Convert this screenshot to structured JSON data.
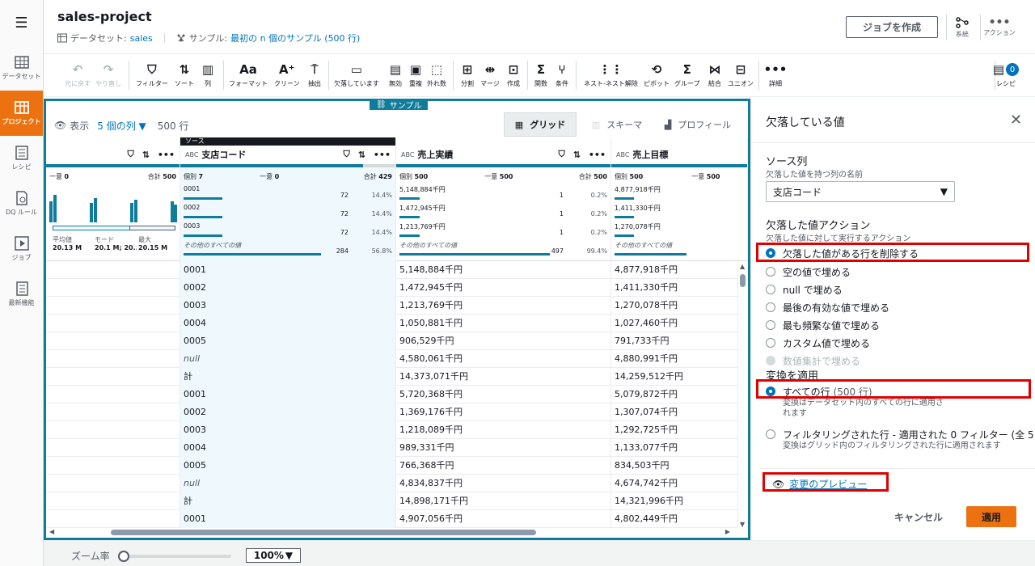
{
  "leftnav": {
    "items": [
      {
        "label": "データセット",
        "icon": "table-icon"
      },
      {
        "label": "プロジェクト",
        "icon": "project-icon"
      },
      {
        "label": "レシピ",
        "icon": "recipe-icon"
      },
      {
        "label": "DQ ルール",
        "icon": "dq-rules-icon"
      },
      {
        "label": "ジョブ",
        "icon": "job-icon"
      },
      {
        "label": "最新機能",
        "icon": "whats-new-icon"
      }
    ]
  },
  "header": {
    "title": "sales-project",
    "dataset_label": "データセット: ",
    "dataset_value": "sales",
    "sample_label": "サンプル: ",
    "sample_value": "最初の n 個のサンプル (500 行)",
    "create_job": "ジョブを作成",
    "lineage": "系統",
    "actions": "アクション"
  },
  "toolbar": {
    "undo": "元に戻す",
    "redo": "やり直し",
    "filter": "フィルター",
    "sort": "ソート",
    "column": "列",
    "format": "フォーマット",
    "clean": "クリーン",
    "extract": "抽出",
    "missing": "欠落しています",
    "invalid": "無効",
    "duplicates": "重複",
    "outliers": "外れ数",
    "split": "分割",
    "merge": "マージ",
    "create": "作成",
    "functions": "関数",
    "condition": "条件",
    "unnest": "ネスト-ネスト解除",
    "pivot": "ピボット",
    "group": "グループ",
    "join": "結合",
    "union": "ユニオン",
    "more": "詳細",
    "recipe": "レシピ",
    "recipe_count": "0"
  },
  "grid": {
    "sample_tag": "サンプル",
    "show_label": "表示",
    "columns_link": "5 個の列",
    "rows_count": "500 行",
    "view_tabs": [
      "グリッド",
      "スキーマ",
      "プロフィール"
    ],
    "source_label": "ソース",
    "columns": [
      {
        "name": "",
        "type": ""
      },
      {
        "name": "支店コード",
        "type": "ABC"
      },
      {
        "name": "売上実績",
        "type": "ABC"
      },
      {
        "name": "売上目標",
        "type": "ABC"
      }
    ],
    "stats": {
      "col0": {
        "unique_label": "一意",
        "unique": "0",
        "total_label": "合計",
        "total": "500",
        "mean_label": "平均値",
        "mean": "20.13 M",
        "mode_label": "モード",
        "mode": "20.1 M; 20....",
        "max_label": "最大",
        "max": "20.15 M"
      },
      "col1": {
        "distinct_label": "個別",
        "distinct": "7",
        "unique_label": "一意",
        "unique": "0",
        "total_label": "合計",
        "total": "429",
        "rows": [
          {
            "label": "0001",
            "count": "72",
            "pct": "14.4%",
            "fill": 0.144
          },
          {
            "label": "0002",
            "count": "72",
            "pct": "14.4%",
            "fill": 0.144
          },
          {
            "label": "0003",
            "count": "72",
            "pct": "14.4%",
            "fill": 0.144
          },
          {
            "label": "その他のすべての値",
            "count": "284",
            "pct": "56.8%",
            "fill": 0.568
          }
        ]
      },
      "col2": {
        "distinct_label": "個別",
        "distinct": "500",
        "unique_label": "一意",
        "unique": "500",
        "total_label": "合計",
        "total": "500",
        "rows": [
          {
            "label": "5,148,884千円",
            "count": "1",
            "pct": "0.2%",
            "fill": 0.002
          },
          {
            "label": "1,472,945千円",
            "count": "1",
            "pct": "0.2%",
            "fill": 0.002
          },
          {
            "label": "1,213,769千円",
            "count": "1",
            "pct": "0.2%",
            "fill": 0.002
          },
          {
            "label": "その他のすべての値",
            "count": "497",
            "pct": "99.4%",
            "fill": 0.994
          }
        ]
      },
      "col3": {
        "distinct_label": "個別",
        "distinct": "500",
        "unique_label": "一意",
        "unique": "500",
        "rows": [
          {
            "label": "4,877,918千円"
          },
          {
            "label": "1,411,330千円"
          },
          {
            "label": "1,270,078千円"
          },
          {
            "label": "その他のすべての値"
          }
        ]
      }
    },
    "rows": [
      [
        "0001",
        "5,148,884千円",
        "4,877,918千円"
      ],
      [
        "0002",
        "1,472,945千円",
        "1,411,330千円"
      ],
      [
        "0003",
        "1,213,769千円",
        "1,270,078千円"
      ],
      [
        "0004",
        "1,050,881千円",
        "1,027,460千円"
      ],
      [
        "0005",
        "906,529千円",
        "791,733千円"
      ],
      [
        "null",
        "4,580,061千円",
        "4,880,991千円"
      ],
      [
        "計",
        "14,373,071千円",
        "14,259,512千円"
      ],
      [
        "0001",
        "5,720,368千円",
        "5,079,872千円"
      ],
      [
        "0002",
        "1,369,176千円",
        "1,307,074千円"
      ],
      [
        "0003",
        "1,218,089千円",
        "1,292,725千円"
      ],
      [
        "0004",
        "989,331千円",
        "1,133,077千円"
      ],
      [
        "0005",
        "766,368千円",
        "834,503千円"
      ],
      [
        "null",
        "4,834,837千円",
        "4,674,742千円"
      ],
      [
        "計",
        "14,898,171千円",
        "14,321,996千円"
      ],
      [
        "0001",
        "4,907,056千円",
        "4,802,449千円"
      ]
    ]
  },
  "panel": {
    "title": "欠落している値",
    "source_col_label": "ソース列",
    "source_col_sub": "欠落した値を持つ列の名前",
    "source_col_value": "支店コード",
    "action_label": "欠落した値アクション",
    "action_sub": "欠落した値に対して実行するアクション",
    "actions": [
      "欠落した値がある行を削除する",
      "空の値で埋める",
      "null で埋める",
      "最後の有効な値で埋める",
      "最も頻繁な値で埋める",
      "カスタム値で埋める",
      "数値集計で埋める"
    ],
    "apply_label": "変換を適用",
    "apply_all": "すべての行",
    "apply_all_count": "(500 行)",
    "apply_all_desc_1": "変換はデータセット内のすべての行に適用さ",
    "apply_all_desc_2": "れます",
    "apply_filtered": "フィルタリングされた行 - 適用された 0 フィルター (全 5",
    "apply_filtered_desc": "変換はグリッド内のフィルタリングされた行に適用されます",
    "preview": "変更のプレビュー",
    "cancel": "キャンセル",
    "apply": "適用"
  },
  "bottom": {
    "zoom_label": "ズーム率",
    "zoom_value": "100%"
  },
  "colors": {
    "accent": "#ec7211",
    "link": "#0073bb",
    "teal": "#0e7c9a",
    "highlight": "#e00000"
  }
}
